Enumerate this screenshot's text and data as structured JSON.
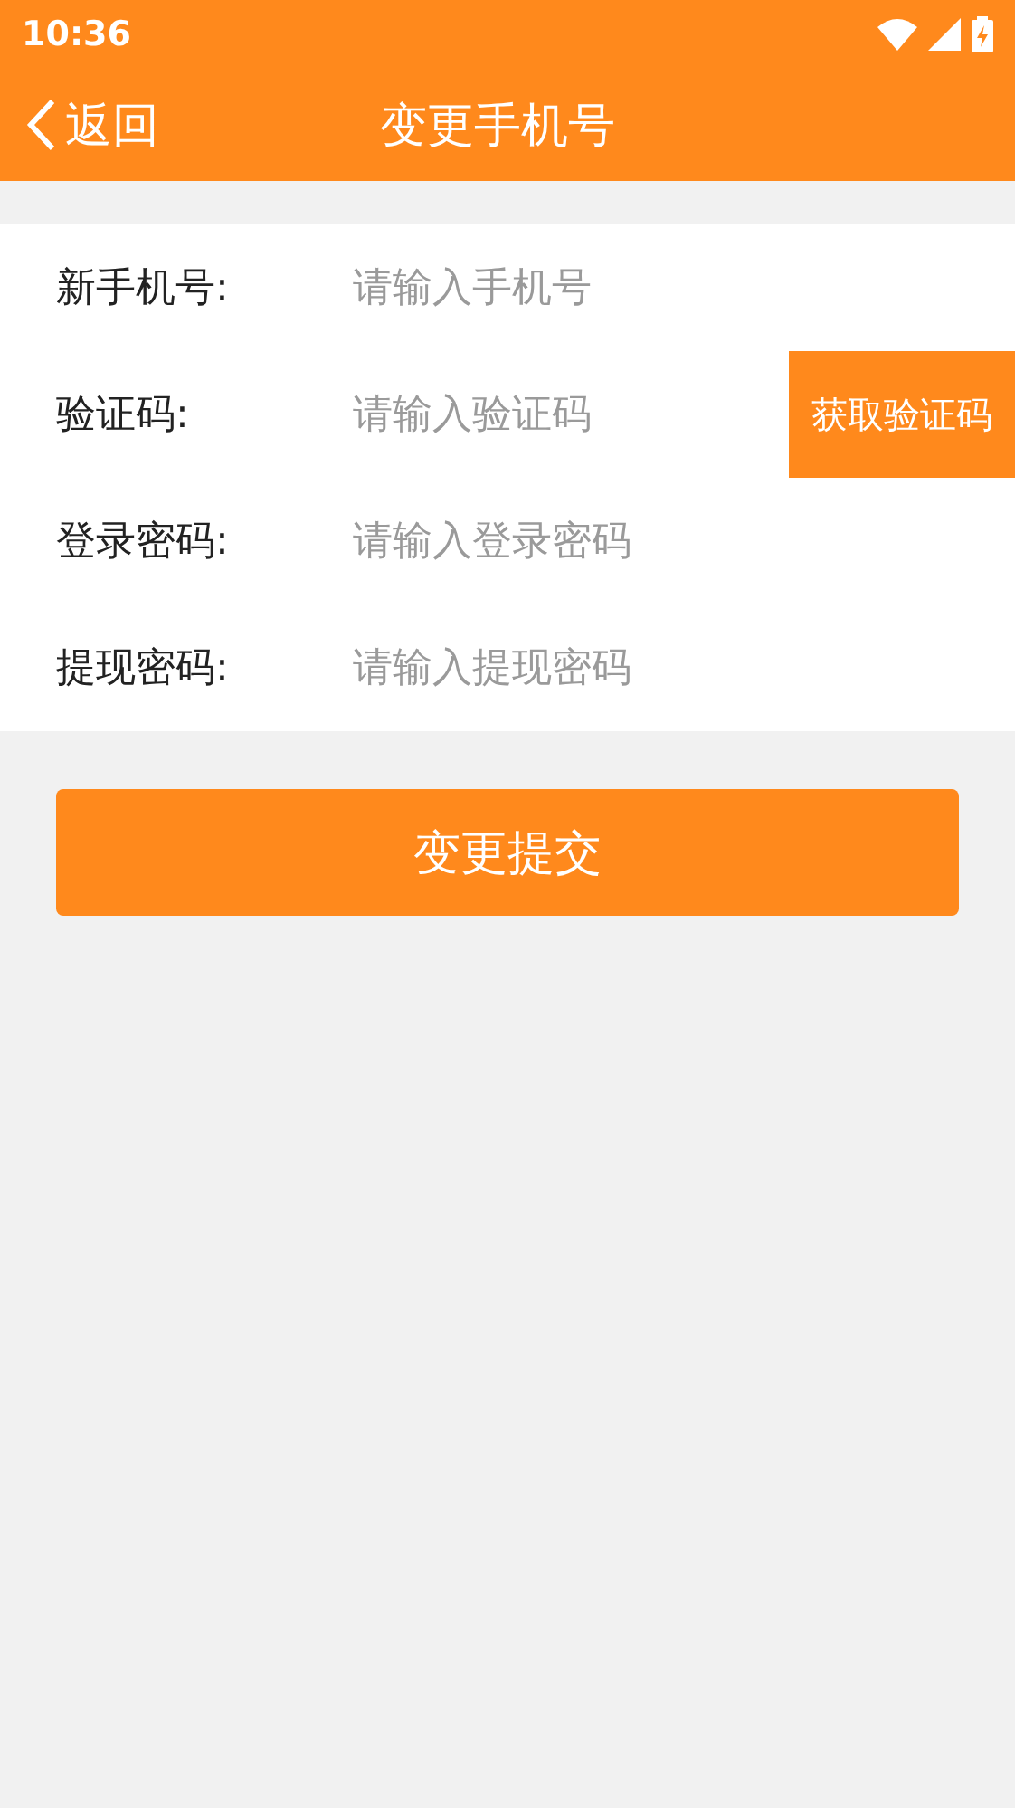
{
  "status_bar": {
    "time": "10:36"
  },
  "header": {
    "back": "返回",
    "title": "变更手机号"
  },
  "fields": [
    {
      "label": "新手机号:",
      "placeholder": "请输入手机号"
    },
    {
      "label": "验证码:",
      "placeholder": "请输入验证码",
      "action": "获取验证码"
    },
    {
      "label": "登录密码:",
      "placeholder": "请输入登录密码"
    },
    {
      "label": "提现密码:",
      "placeholder": "请输入提现密码"
    }
  ],
  "submit": "变更提交"
}
